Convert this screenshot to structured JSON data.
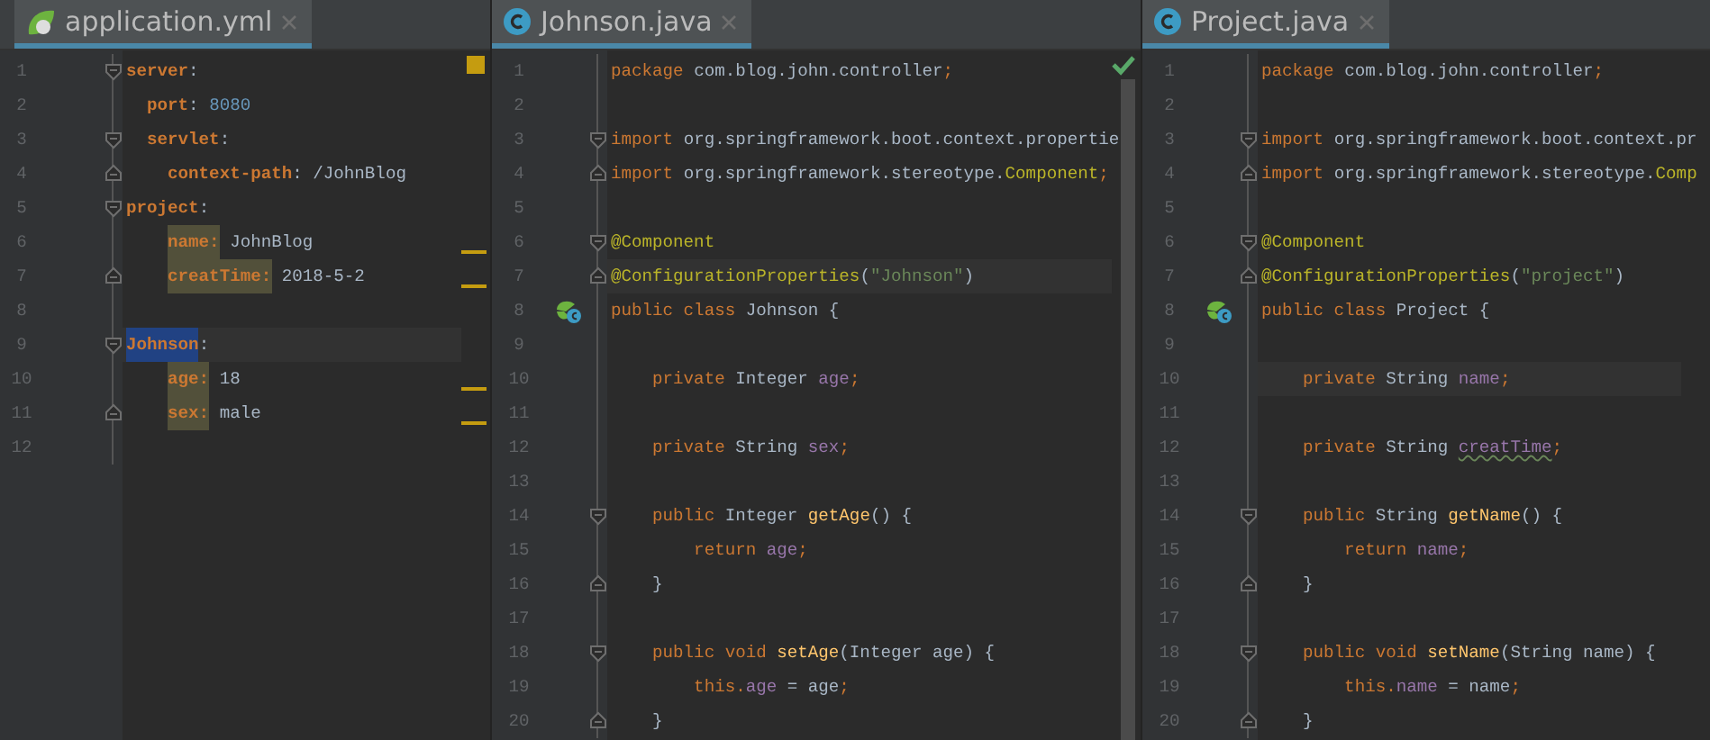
{
  "panes": [
    {
      "kind": "yaml",
      "tab": {
        "label": "application.yml",
        "selected": true
      },
      "status": {
        "kind": "warning"
      },
      "lines": [
        {
          "number": "1",
          "kind": "fold-start",
          "current": false,
          "marked": false,
          "tokens": [
            {
              "text": "server",
              "kind": "key"
            },
            {
              "text": ":",
              "kind": "plain"
            }
          ]
        },
        {
          "number": "2",
          "kind": "plain",
          "current": false,
          "marked": false,
          "tokens": [
            {
              "text": "  port",
              "kind": "key"
            },
            {
              "text": ": ",
              "kind": "plain"
            },
            {
              "text": "8080",
              "kind": "number"
            }
          ]
        },
        {
          "number": "3",
          "kind": "fold-start",
          "current": false,
          "marked": false,
          "tokens": [
            {
              "text": "  servlet",
              "kind": "key"
            },
            {
              "text": ":",
              "kind": "plain"
            }
          ]
        },
        {
          "number": "4",
          "kind": "fold-end",
          "current": false,
          "marked": false,
          "tokens": [
            {
              "text": "    context-path",
              "kind": "key"
            },
            {
              "text": ": /JohnBlog",
              "kind": "plain"
            }
          ]
        },
        {
          "number": "5",
          "kind": "fold-start",
          "current": false,
          "marked": false,
          "tokens": [
            {
              "text": "project",
              "kind": "key"
            },
            {
              "text": ":",
              "kind": "plain"
            }
          ]
        },
        {
          "number": "6",
          "kind": "plain",
          "current": false,
          "marked": true,
          "tokens": [
            {
              "text": "    name:",
              "kind": "key-usage"
            },
            {
              "text": " JohnBlog",
              "kind": "plain"
            }
          ]
        },
        {
          "number": "7",
          "kind": "fold-end",
          "current": false,
          "marked": true,
          "tokens": [
            {
              "text": "    creatTime:",
              "kind": "key-usage"
            },
            {
              "text": " 2018-5-2",
              "kind": "plain"
            }
          ]
        },
        {
          "number": "8",
          "kind": "plain",
          "current": false,
          "marked": false
        },
        {
          "number": "9",
          "kind": "fold-start",
          "current": true,
          "marked": false,
          "tokens": [
            {
              "text": "Johnson",
              "kind": "key-selected"
            },
            {
              "text": ":",
              "kind": "plain"
            }
          ]
        },
        {
          "number": "10",
          "kind": "plain",
          "current": false,
          "marked": true,
          "tokens": [
            {
              "text": "    age:",
              "kind": "key-usage"
            },
            {
              "text": " 18",
              "kind": "plain"
            }
          ]
        },
        {
          "number": "11",
          "kind": "fold-end",
          "current": false,
          "marked": true,
          "tokens": [
            {
              "text": "    sex:",
              "kind": "key-usage"
            },
            {
              "text": " male",
              "kind": "plain"
            }
          ]
        },
        {
          "number": "12",
          "kind": "plain",
          "current": false,
          "marked": false
        }
      ]
    },
    {
      "kind": "java",
      "tab": {
        "label": "Johnson.java",
        "selected": true
      },
      "status": {
        "kind": "ok"
      },
      "lines": [
        {
          "number": "1",
          "kind": "plain",
          "current": false,
          "tokens": [
            {
              "text": "package ",
              "kind": "keyword"
            },
            {
              "text": "com.blog.john.controller",
              "kind": "plain"
            },
            {
              "text": ";",
              "kind": "keyword"
            }
          ]
        },
        {
          "number": "2",
          "kind": "plain",
          "current": false
        },
        {
          "number": "3",
          "kind": "fold-start",
          "current": false,
          "tokens": [
            {
              "text": "import ",
              "kind": "keyword"
            },
            {
              "text": "org.springframework.boot.context.propertie",
              "kind": "plain"
            }
          ]
        },
        {
          "number": "4",
          "kind": "fold-end",
          "current": false,
          "tokens": [
            {
              "text": "import ",
              "kind": "keyword"
            },
            {
              "text": "org.springframework.stereotype.",
              "kind": "plain"
            },
            {
              "text": "Component",
              "kind": "annotation"
            },
            {
              "text": ";",
              "kind": "keyword"
            }
          ]
        },
        {
          "number": "5",
          "kind": "plain",
          "current": false
        },
        {
          "number": "6",
          "kind": "fold-start",
          "current": false,
          "tokens": [
            {
              "text": "@Component",
              "kind": "annotation"
            }
          ]
        },
        {
          "number": "7",
          "kind": "fold-end",
          "current": true,
          "tokens": [
            {
              "text": "@ConfigurationProperties",
              "kind": "annotation"
            },
            {
              "text": "(",
              "kind": "plain"
            },
            {
              "text": "\"Johnson\"",
              "kind": "string"
            },
            {
              "text": ")",
              "kind": "plain"
            }
          ]
        },
        {
          "number": "8",
          "kind": "bean",
          "current": false,
          "tokens": [
            {
              "text": "public class ",
              "kind": "keyword"
            },
            {
              "text": "Johnson {",
              "kind": "plain"
            }
          ]
        },
        {
          "number": "9",
          "kind": "plain",
          "current": false
        },
        {
          "number": "10",
          "kind": "plain",
          "current": false,
          "tokens": [
            {
              "text": "    private ",
              "kind": "keyword"
            },
            {
              "text": "Integer ",
              "kind": "plain"
            },
            {
              "text": "age",
              "kind": "field"
            },
            {
              "text": ";",
              "kind": "keyword"
            }
          ]
        },
        {
          "number": "11",
          "kind": "plain",
          "current": false
        },
        {
          "number": "12",
          "kind": "plain",
          "current": false,
          "tokens": [
            {
              "text": "    private ",
              "kind": "keyword"
            },
            {
              "text": "String ",
              "kind": "plain"
            },
            {
              "text": "sex",
              "kind": "field"
            },
            {
              "text": ";",
              "kind": "keyword"
            }
          ]
        },
        {
          "number": "13",
          "kind": "plain",
          "current": false
        },
        {
          "number": "14",
          "kind": "fold-start",
          "current": false,
          "tokens": [
            {
              "text": "    public ",
              "kind": "keyword"
            },
            {
              "text": "Integer ",
              "kind": "plain"
            },
            {
              "text": "getAge",
              "kind": "method"
            },
            {
              "text": "() {",
              "kind": "plain"
            }
          ]
        },
        {
          "number": "15",
          "kind": "plain",
          "current": false,
          "tokens": [
            {
              "text": "        return ",
              "kind": "keyword"
            },
            {
              "text": "age",
              "kind": "field"
            },
            {
              "text": ";",
              "kind": "keyword"
            }
          ]
        },
        {
          "number": "16",
          "kind": "fold-end",
          "current": false,
          "tokens": [
            {
              "text": "    }",
              "kind": "plain"
            }
          ]
        },
        {
          "number": "17",
          "kind": "plain",
          "current": false
        },
        {
          "number": "18",
          "kind": "fold-start",
          "current": false,
          "tokens": [
            {
              "text": "    public void ",
              "kind": "keyword"
            },
            {
              "text": "setAge",
              "kind": "method"
            },
            {
              "text": "(Integer age) {",
              "kind": "plain"
            }
          ]
        },
        {
          "number": "19",
          "kind": "plain",
          "current": false,
          "tokens": [
            {
              "text": "        this.",
              "kind": "keyword"
            },
            {
              "text": "age",
              "kind": "field"
            },
            {
              "text": " = age",
              "kind": "plain"
            },
            {
              "text": ";",
              "kind": "keyword"
            }
          ]
        },
        {
          "number": "20",
          "kind": "fold-end",
          "current": false,
          "tokens": [
            {
              "text": "    }",
              "kind": "plain"
            }
          ]
        }
      ]
    },
    {
      "kind": "java",
      "tab": {
        "label": "Project.java",
        "selected": true
      },
      "lines": [
        {
          "number": "1",
          "kind": "plain",
          "current": false,
          "tokens": [
            {
              "text": "package ",
              "kind": "keyword"
            },
            {
              "text": "com.blog.john.controller",
              "kind": "plain"
            },
            {
              "text": ";",
              "kind": "keyword"
            }
          ]
        },
        {
          "number": "2",
          "kind": "plain",
          "current": false
        },
        {
          "number": "3",
          "kind": "fold-start",
          "current": false,
          "tokens": [
            {
              "text": "import ",
              "kind": "keyword"
            },
            {
              "text": "org.springframework.boot.context.pr",
              "kind": "plain"
            }
          ]
        },
        {
          "number": "4",
          "kind": "fold-end",
          "current": false,
          "tokens": [
            {
              "text": "import ",
              "kind": "keyword"
            },
            {
              "text": "org.springframework.stereotype.",
              "kind": "plain"
            },
            {
              "text": "Comp",
              "kind": "annotation"
            }
          ]
        },
        {
          "number": "5",
          "kind": "plain",
          "current": false
        },
        {
          "number": "6",
          "kind": "fold-start",
          "current": false,
          "tokens": [
            {
              "text": "@Component",
              "kind": "annotation"
            }
          ]
        },
        {
          "number": "7",
          "kind": "fold-end",
          "current": false,
          "tokens": [
            {
              "text": "@ConfigurationProperties",
              "kind": "annotation"
            },
            {
              "text": "(",
              "kind": "plain"
            },
            {
              "text": "\"project\"",
              "kind": "string"
            },
            {
              "text": ")",
              "kind": "plain"
            }
          ]
        },
        {
          "number": "8",
          "kind": "bean",
          "current": false,
          "tokens": [
            {
              "text": "public class ",
              "kind": "keyword"
            },
            {
              "text": "Project {",
              "kind": "plain"
            }
          ]
        },
        {
          "number": "9",
          "kind": "plain",
          "current": false
        },
        {
          "number": "10",
          "kind": "plain",
          "current": true,
          "tokens": [
            {
              "text": "    private ",
              "kind": "keyword"
            },
            {
              "text": "String ",
              "kind": "plain"
            },
            {
              "text": "name",
              "kind": "field"
            },
            {
              "text": ";",
              "kind": "keyword"
            }
          ]
        },
        {
          "number": "11",
          "kind": "plain",
          "current": false
        },
        {
          "number": "12",
          "kind": "plain",
          "current": false,
          "tokens": [
            {
              "text": "    private ",
              "kind": "keyword"
            },
            {
              "text": "String ",
              "kind": "plain"
            },
            {
              "text": "creatTime",
              "kind": "field-typo"
            },
            {
              "text": ";",
              "kind": "keyword"
            }
          ]
        },
        {
          "number": "13",
          "kind": "plain",
          "current": false
        },
        {
          "number": "14",
          "kind": "fold-start",
          "current": false,
          "tokens": [
            {
              "text": "    public ",
              "kind": "keyword"
            },
            {
              "text": "String ",
              "kind": "plain"
            },
            {
              "text": "getName",
              "kind": "method"
            },
            {
              "text": "() {",
              "kind": "plain"
            }
          ]
        },
        {
          "number": "15",
          "kind": "plain",
          "current": false,
          "tokens": [
            {
              "text": "        return ",
              "kind": "keyword"
            },
            {
              "text": "name",
              "kind": "field"
            },
            {
              "text": ";",
              "kind": "keyword"
            }
          ]
        },
        {
          "number": "16",
          "kind": "fold-end",
          "current": false,
          "tokens": [
            {
              "text": "    }",
              "kind": "plain"
            }
          ]
        },
        {
          "number": "17",
          "kind": "plain",
          "current": false
        },
        {
          "number": "18",
          "kind": "fold-start",
          "current": false,
          "tokens": [
            {
              "text": "    public void ",
              "kind": "keyword"
            },
            {
              "text": "setName",
              "kind": "method"
            },
            {
              "text": "(String name) {",
              "kind": "plain"
            }
          ]
        },
        {
          "number": "19",
          "kind": "plain",
          "current": false,
          "tokens": [
            {
              "text": "        this.",
              "kind": "keyword"
            },
            {
              "text": "name",
              "kind": "field"
            },
            {
              "text": " = name",
              "kind": "plain"
            },
            {
              "text": ";",
              "kind": "keyword"
            }
          ]
        },
        {
          "number": "20",
          "kind": "fold-end",
          "current": false,
          "tokens": [
            {
              "text": "    }",
              "kind": "plain"
            }
          ]
        }
      ]
    }
  ]
}
